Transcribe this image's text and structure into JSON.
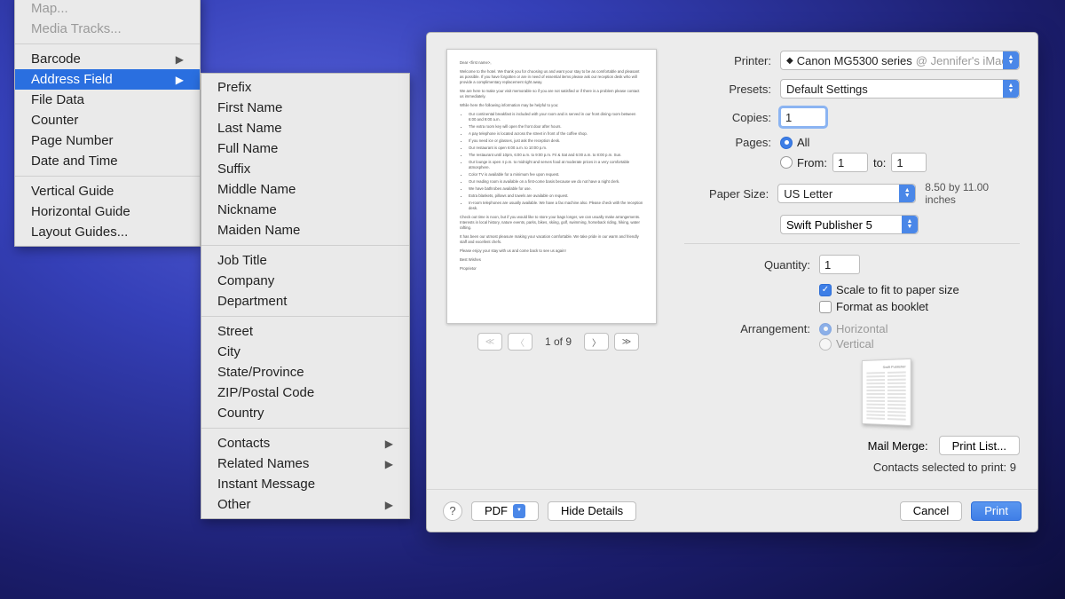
{
  "menu_main": {
    "group_top": [
      {
        "label": "Map...",
        "disabled": true
      },
      {
        "label": "Media Tracks...",
        "disabled": true
      }
    ],
    "group_insert": [
      {
        "label": "Barcode",
        "submenu": true
      },
      {
        "label": "Address Field",
        "submenu": true,
        "selected": true
      },
      {
        "label": "File Data"
      },
      {
        "label": "Counter"
      },
      {
        "label": "Page Number"
      },
      {
        "label": "Date and Time"
      }
    ],
    "group_guides": [
      {
        "label": "Vertical Guide"
      },
      {
        "label": "Horizontal Guide"
      },
      {
        "label": "Layout Guides..."
      }
    ]
  },
  "menu_sub": {
    "group_name": [
      "Prefix",
      "First Name",
      "Last Name",
      "Full Name",
      "Suffix",
      "Middle Name",
      "Nickname",
      "Maiden Name"
    ],
    "group_job": [
      "Job Title",
      "Company",
      "Department"
    ],
    "group_addr": [
      "Street",
      "City",
      "State/Province",
      "ZIP/Postal Code",
      "Country"
    ],
    "group_more": [
      {
        "label": "Contacts",
        "submenu": true
      },
      {
        "label": "Related Names",
        "submenu": true
      },
      {
        "label": "Instant Message"
      },
      {
        "label": "Other",
        "submenu": true
      }
    ]
  },
  "dialog": {
    "printer_label": "Printer:",
    "printer_icon": "◆",
    "printer_value": "Canon MG5300 series",
    "printer_at": "@ Jennifer's iMac",
    "presets_label": "Presets:",
    "presets_value": "Default Settings",
    "copies_label": "Copies:",
    "copies_value": "1",
    "pages_label": "Pages:",
    "pages_all": "All",
    "pages_from": "From:",
    "pages_from_v": "1",
    "pages_to": "to:",
    "pages_to_v": "1",
    "paper_label": "Paper Size:",
    "paper_value": "US Letter",
    "paper_note": "8.50 by 11.00 inches",
    "app_select": "Swift Publisher 5",
    "quantity_label": "Quantity:",
    "quantity_value": "1",
    "scale_label": "Scale to fit to paper size",
    "booklet_label": "Format as booklet",
    "arrange_label": "Arrangement:",
    "arrange_h": "Horizontal",
    "arrange_v": "Vertical",
    "booklet_title": "Swift Publisher",
    "mm_label": "Mail Merge:",
    "mm_button": "Print List...",
    "mm_status": "Contacts selected to print: 9",
    "page_count": "1 of 9",
    "pdf_btn": "PDF",
    "hide_btn": "Hide Details",
    "cancel_btn": "Cancel",
    "print_btn": "Print",
    "help": "?"
  }
}
